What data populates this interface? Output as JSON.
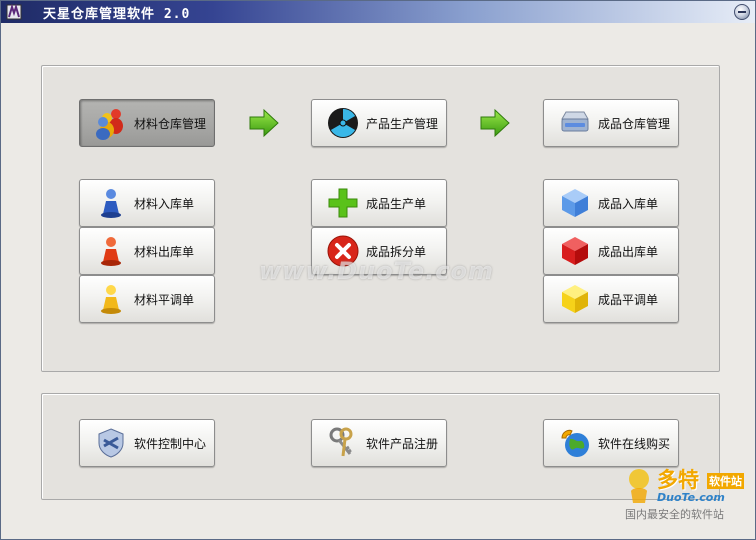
{
  "window": {
    "title": "天星仓库管理软件 2.0",
    "icons": {
      "app": "app-logo-icon",
      "close": "minimize-circle-icon"
    }
  },
  "workflow": {
    "material_warehouse": {
      "label": "材料仓库管理",
      "icon": "people-group-icon",
      "active": true
    },
    "production": {
      "label": "产品生产管理",
      "icon": "radiation-disc-icon"
    },
    "product_warehouse": {
      "label": "成品仓库管理",
      "icon": "hard-drive-icon"
    },
    "arrow_icon": "green-arrow-right-icon"
  },
  "material": {
    "in": {
      "label": "材料入库单",
      "icon": "blue-pawn-icon"
    },
    "out": {
      "label": "材料出库单",
      "icon": "red-pawn-icon"
    },
    "adjust": {
      "label": "材料平调单",
      "icon": "yellow-pawn-icon"
    }
  },
  "production_docs": {
    "produce": {
      "label": "成品生产单",
      "icon": "green-plus-icon"
    },
    "split": {
      "label": "成品拆分单",
      "icon": "red-x-circle-icon"
    }
  },
  "product": {
    "in": {
      "label": "成品入库单",
      "icon": "blue-cube-icon"
    },
    "out": {
      "label": "成品出库单",
      "icon": "red-cube-icon"
    },
    "adjust": {
      "label": "成品平调单",
      "icon": "yellow-cube-icon"
    }
  },
  "bottom": {
    "control": {
      "label": "软件控制中心",
      "icon": "shield-icon"
    },
    "register": {
      "label": "软件产品注册",
      "icon": "keys-icon"
    },
    "buy": {
      "label": "软件在线购买",
      "icon": "globe-phone-icon"
    }
  },
  "watermarks": {
    "center": "www.DuoTe.com",
    "brand": "多特",
    "brand_suffix": "软件站",
    "site": "DuoTe.com",
    "slogan": "国内最安全的软件站"
  },
  "colors": {
    "title_dark": "#1f2b66",
    "title_light": "#e7edf7",
    "arrow": "#5cc21a",
    "watermark_brand": "#f2a800"
  }
}
